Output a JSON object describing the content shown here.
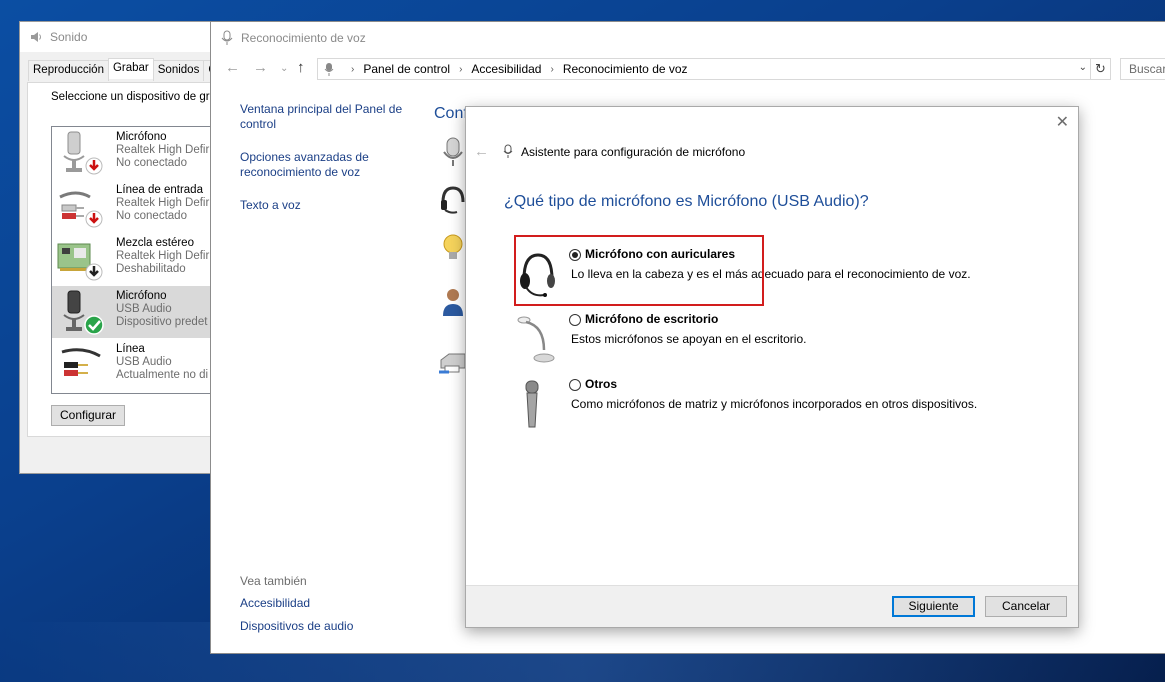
{
  "sound_window": {
    "title": "Sonido",
    "tabs": [
      "Reproducción",
      "Grabar",
      "Sonidos",
      "C"
    ],
    "instruction": "Seleccione un dispositivo de gr",
    "devices": [
      {
        "name": "Micrófono",
        "sub": "Realtek High Defir",
        "status": "No conectado",
        "icon": "microphone-icon",
        "badge": "disconnected"
      },
      {
        "name": "Línea de entrada",
        "sub": "Realtek High Defir",
        "status": "No conectado",
        "icon": "line-in-cable-icon",
        "badge": "disconnected"
      },
      {
        "name": "Mezcla estéreo",
        "sub": "Realtek High Defir",
        "status": "Deshabilitado",
        "icon": "sound-card-icon",
        "badge": "disabled"
      },
      {
        "name": "Micrófono",
        "sub": "USB Audio",
        "status": "Dispositivo predet",
        "icon": "microphone-icon",
        "badge": "default",
        "selected": true
      },
      {
        "name": "Línea",
        "sub": "USB Audio",
        "status": "Actualmente no di",
        "icon": "line-cable-icon",
        "badge": "none"
      }
    ],
    "configure_button": "Configurar"
  },
  "voice_window": {
    "title": "Reconocimiento de voz",
    "breadcrumb": [
      "Panel de control",
      "Accesibilidad",
      "Reconocimiento de voz"
    ],
    "search_placeholder": "Buscar",
    "left_links": [
      "Ventana principal del Panel de control",
      "Opciones avanzadas de reconocimiento de voz",
      "Texto a voz"
    ],
    "see_also_header": "Vea también",
    "see_also_links": [
      "Accesibilidad",
      "Dispositivos de audio"
    ],
    "main_title_partial": "Conf"
  },
  "wizard": {
    "title": "Asistente para configuración de micrófono",
    "question": "¿Qué tipo de micrófono es Micrófono (USB Audio)?",
    "options": [
      {
        "label": "Micrófono con auriculares",
        "description": "Lo lleva en la cabeza y es el más adecuado para el reconocimiento de voz.",
        "selected": true,
        "icon": "headset-icon"
      },
      {
        "label": "Micrófono de escritorio",
        "description": "Estos micrófonos se apoyan en el escritorio.",
        "selected": false,
        "icon": "desktop-microphone-icon"
      },
      {
        "label": "Otros",
        "description": "Como micrófonos de matriz y micrófonos incorporados en otros dispositivos.",
        "selected": false,
        "icon": "handheld-microphone-icon"
      }
    ],
    "next_button": "Siguiente",
    "cancel_button": "Cancelar"
  },
  "colors": {
    "accent": "#0078d7",
    "link": "#1b3f86",
    "heading": "#1e4e99",
    "highlight_border": "#d21d1d"
  }
}
